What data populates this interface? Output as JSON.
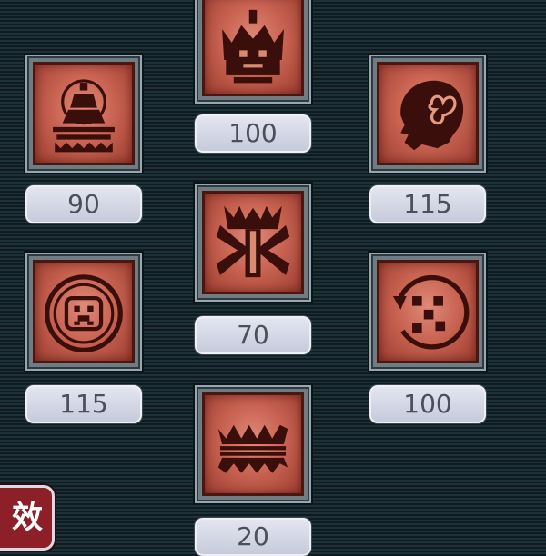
{
  "skills": [
    {
      "id": "crown",
      "icon": "crown-icon",
      "value": "100"
    },
    {
      "id": "pagoda",
      "icon": "pagoda-icon",
      "value": "90"
    },
    {
      "id": "head",
      "icon": "head-butterfly-icon",
      "value": "115"
    },
    {
      "id": "mantis",
      "icon": "mantis-claw-icon",
      "value": "70"
    },
    {
      "id": "circle-sigil",
      "icon": "circle-sigil-icon",
      "value": "115"
    },
    {
      "id": "dotted-circle",
      "icon": "dotted-circle-icon",
      "value": "100"
    },
    {
      "id": "fangs",
      "icon": "fangs-icon",
      "value": "20"
    }
  ],
  "badge": {
    "label": "效"
  },
  "colors": {
    "icon_bg": "#c96352",
    "icon_dark": "#4a1710",
    "value_bg": "#d4d8e6",
    "value_text": "#4b4f5a",
    "badge_bg": "#8c1f27"
  }
}
